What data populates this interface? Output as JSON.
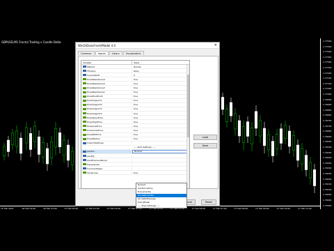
{
  "chart": {
    "title": "GBPUSD,M1  Fractal Trading v Candle Delta",
    "price_labels": [
      "1.77500",
      "1.77450",
      "1.77400",
      "1.77350",
      "1.77300",
      "1.77250",
      "1.77200",
      "1.77150",
      "1.77100",
      "1.77050",
      "1.77000",
      "1.76950",
      "1.76900",
      "1.76850",
      "1.76800",
      "1.76750",
      "1.76700",
      "1.76650",
      "1.76600",
      "1.76550",
      "1.76500",
      "1.76450",
      "1.76400",
      "1.76350",
      "1.76300",
      "1.76250",
      "1.76200",
      "1.76150",
      "1.76100",
      "1.76050",
      "1.76000",
      "1.75950"
    ],
    "time_labels": [
      "15 Feb 2021",
      "16 Feb 22:00",
      "16 Feb 23:00",
      "17 Feb 00:00",
      "17 Feb 01:00",
      "17 Feb 02:00",
      "17 Feb 03:00",
      "17 Feb 04:00",
      "17 Feb 05:00",
      "17 Feb 06:00",
      "17 Feb 07:00",
      "17 Feb 08:00",
      "17 Feb 09:00",
      "17 Feb 10:00",
      "17 Feb 11:00"
    ]
  },
  "dialog": {
    "title": "WinOrDoesFresh/Model 4.0",
    "close_label": "✕",
    "tabs": [
      "Common",
      "Inputs",
      "Colors",
      "Visualization"
    ],
    "columns": {
      "variable": "Variable",
      "value": "Value"
    },
    "rows": [
      {
        "variable": "Method",
        "value": "Handle",
        "icon": "blue"
      },
      {
        "variable": "TFInterp",
        "value": "Daily",
        "icon": "blue"
      },
      {
        "variable": "CurrentShift",
        "value": "0",
        "icon": "blue"
      },
      {
        "variable": "DrawResistance4",
        "value": "true",
        "icon": "green"
      },
      {
        "variable": "DrawResistance3",
        "value": "true",
        "icon": "green"
      },
      {
        "variable": "DrawResistance2",
        "value": "true",
        "icon": "green"
      },
      {
        "variable": "DrawResistance1",
        "value": "true",
        "icon": "green"
      },
      {
        "variable": "DrawPivotPoint",
        "value": "true",
        "icon": "green"
      },
      {
        "variable": "DrawSupport1",
        "value": "true",
        "icon": "green"
      },
      {
        "variable": "DrawSupport2",
        "value": "true",
        "icon": "green"
      },
      {
        "variable": "DrawSupport3",
        "value": "true",
        "icon": "green"
      },
      {
        "variable": "DrawSupport4",
        "value": "true",
        "icon": "green"
      },
      {
        "variable": "DrawOpenPrice",
        "value": "true",
        "icon": "green"
      },
      {
        "variable": "DrawHighPrice",
        "value": "true",
        "icon": "green"
      },
      {
        "variable": "DrawLowPrice",
        "value": "true",
        "icon": "green"
      },
      {
        "variable": "DrawClosePrice",
        "value": "true",
        "icon": "green"
      },
      {
        "variable": "DrawMidPrice",
        "value": "true",
        "icon": "green"
      },
      {
        "variable": "DrawMedian",
        "value": "true",
        "icon": "green"
      },
      {
        "variable": "CustomSettings",
        "value": "",
        "icon": "blue"
      },
      {
        "variable": "",
        "value": "---- Alert Settings ----",
        "icon": "none"
      },
      {
        "variable": "AlertLC",
        "value": "NoAlert",
        "icon": "blue",
        "selected": true
      },
      {
        "variable": "AlertDJ",
        "value": "",
        "icon": "blue"
      },
      {
        "variable": "AlertPreviousPeriod",
        "value": "",
        "icon": "blue"
      },
      {
        "variable": "PopupAlerts",
        "value": "",
        "icon": "green"
      },
      {
        "variable": "CommentStyle",
        "value": "",
        "icon": "blue"
      },
      {
        "variable": "ShowLines",
        "value": "true",
        "icon": "green"
      }
    ],
    "dropdown_options": [
      "NoAlert",
      "AlertOnceOnly",
      "EveryCandle",
      "OncePerCandle",
      "OncePerMessage",
      "EveryBreak"
    ],
    "dropdown_selected_index": 3,
    "style_settings_row": "---- Style Settings ----",
    "side_buttons": {
      "load": "Load",
      "save": "Save"
    },
    "bottom_buttons": {
      "ok": "OK",
      "cancel": "Cancel",
      "reset": "Reset"
    }
  }
}
